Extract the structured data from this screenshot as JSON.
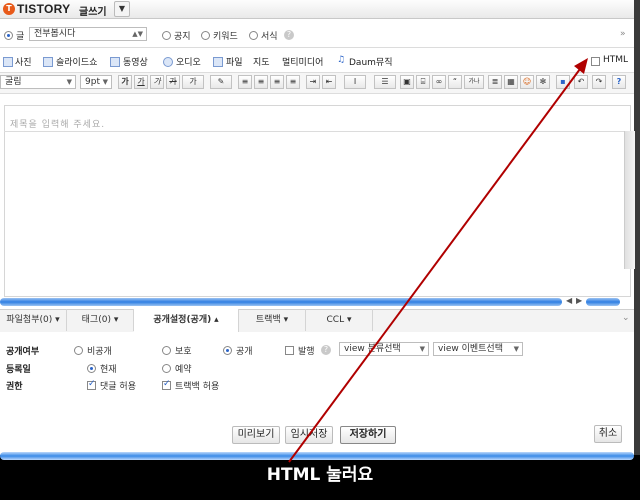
{
  "header": {
    "logo_mark": "T",
    "logo": "TISTORY",
    "title": "글쓰기",
    "dropdown_arrow": "▼"
  },
  "row1": {
    "type_label": "글",
    "category": "전부봅시다",
    "opt_notice": "공지",
    "opt_keyword": "키워드",
    "opt_format": "서식"
  },
  "media_toolbar": {
    "items": [
      "사진",
      "슬라이드쇼",
      "동영상",
      "오디오",
      "파일",
      "지도",
      "멀티미디어",
      "Daum뮤직"
    ],
    "html_label": "HTML",
    "expand": "»"
  },
  "format_toolbar": {
    "font": "굴림",
    "size": "9pt",
    "more": "»"
  },
  "editor": {
    "title_placeholder": "제목을 입력해 주세요."
  },
  "tabs": [
    {
      "label": "파일첨부(0)"
    },
    {
      "label": "태그(0)"
    },
    {
      "label": "공개설정(공개)"
    },
    {
      "label": "트랙백"
    },
    {
      "label": "CCL"
    }
  ],
  "settings": {
    "visibility_label": "공개여부",
    "vis_private": "비공개",
    "vis_protect": "보호",
    "vis_public": "공개",
    "publish_label": "발행",
    "cat_select": "view 분류선택",
    "event_select": "view 이벤트선택",
    "date_label": "등록일",
    "date_now": "현재",
    "date_reserve": "예약",
    "perm_label": "권한",
    "perm_comment": "댓글 허용",
    "perm_trackback": "트랙백 허용"
  },
  "actions": {
    "preview": "미리보기",
    "temp_save": "임시저장",
    "save": "저장하기",
    "cancel": "취소"
  },
  "annotation": {
    "caption": "HTML 눌러요",
    "arrow_color": "#b00000"
  },
  "colors": {
    "accent": "#2f7fe3",
    "tab_active": "#c0392b",
    "logo": "#e85a1a"
  }
}
